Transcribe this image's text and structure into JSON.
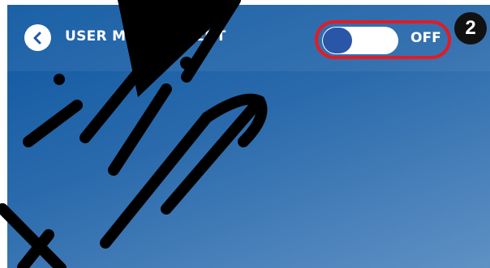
{
  "header": {
    "title": "USER MANAGEMENT",
    "back_icon": "chevron-left-icon"
  },
  "toggle": {
    "state_label": "OFF",
    "on": false,
    "highlight_color": "#e31b23"
  },
  "callout": {
    "number": "2"
  },
  "colors": {
    "background_top": "#0d57a1",
    "background_bottom": "#5f91c4",
    "toggle_knob": "#2a56a8"
  },
  "watermark": {
    "icon": "watermark-script"
  }
}
